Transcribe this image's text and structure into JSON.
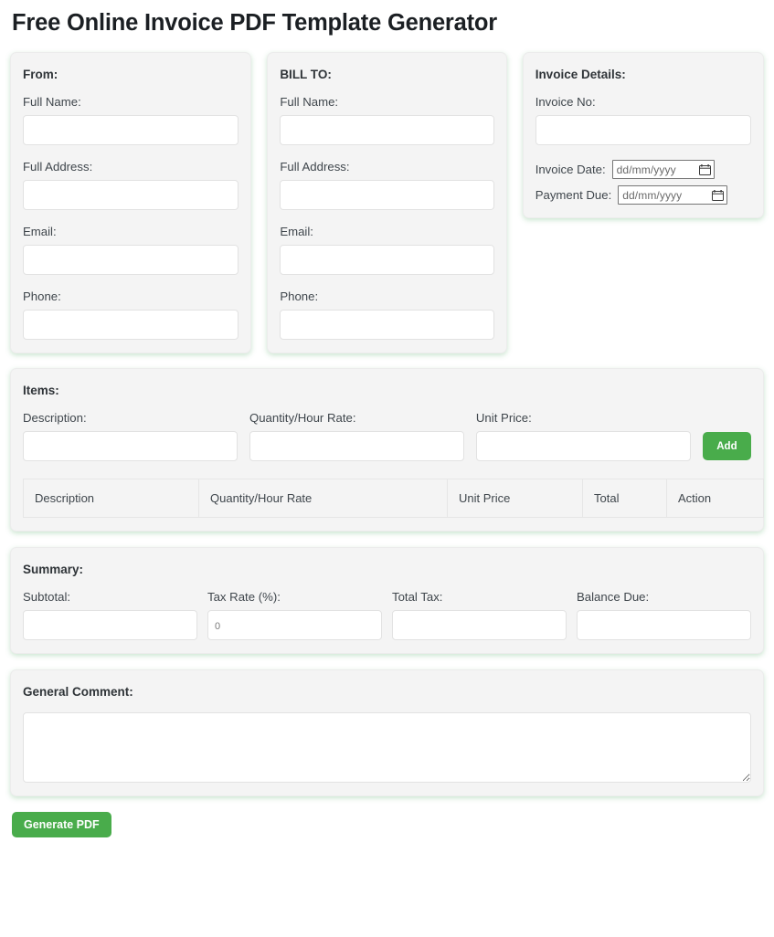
{
  "page": {
    "title": "Free Online Invoice PDF Template Generator"
  },
  "from_panel": {
    "heading": "From:",
    "full_name_label": "Full Name:",
    "full_name_value": "",
    "full_address_label": "Full Address:",
    "full_address_value": "",
    "email_label": "Email:",
    "email_value": "",
    "phone_label": "Phone:",
    "phone_value": ""
  },
  "bill_to_panel": {
    "heading": "BILL TO:",
    "full_name_label": "Full Name:",
    "full_name_value": "",
    "full_address_label": "Full Address:",
    "full_address_value": "",
    "email_label": "Email:",
    "email_value": "",
    "phone_label": "Phone:",
    "phone_value": ""
  },
  "invoice_details_panel": {
    "heading": "Invoice Details:",
    "invoice_no_label": "Invoice No:",
    "invoice_no_value": "",
    "invoice_date_label": "Invoice Date:",
    "invoice_date_placeholder": "dd/mm/yyyy",
    "payment_due_label": "Payment Due:",
    "payment_due_placeholder": "dd/mm/yyyy",
    "calendar_icon": "calendar-icon"
  },
  "items_panel": {
    "heading": "Items:",
    "description_label": "Description:",
    "description_value": "",
    "quantity_label": "Quantity/Hour Rate:",
    "quantity_value": "",
    "unit_price_label": "Unit Price:",
    "unit_price_value": "",
    "add_button_label": "Add",
    "table": {
      "columns": [
        "Description",
        "Quantity/Hour Rate",
        "Unit Price",
        "Total",
        "Action"
      ],
      "rows": []
    }
  },
  "summary_panel": {
    "heading": "Summary:",
    "subtotal_label": "Subtotal:",
    "subtotal_value": "",
    "tax_rate_label": "Tax Rate (%):",
    "tax_rate_value": "0",
    "total_tax_label": "Total Tax:",
    "total_tax_value": "",
    "balance_due_label": "Balance Due:",
    "balance_due_value": ""
  },
  "comment_panel": {
    "heading": "General Comment:",
    "comment_value": ""
  },
  "actions": {
    "generate_pdf_label": "Generate PDF"
  },
  "colors": {
    "accent_green": "#49ac4b",
    "panel_background": "#f4f4f4",
    "panel_shadow_green": "#50aa64",
    "input_background": "#ffffff",
    "text": "#3f464c"
  }
}
